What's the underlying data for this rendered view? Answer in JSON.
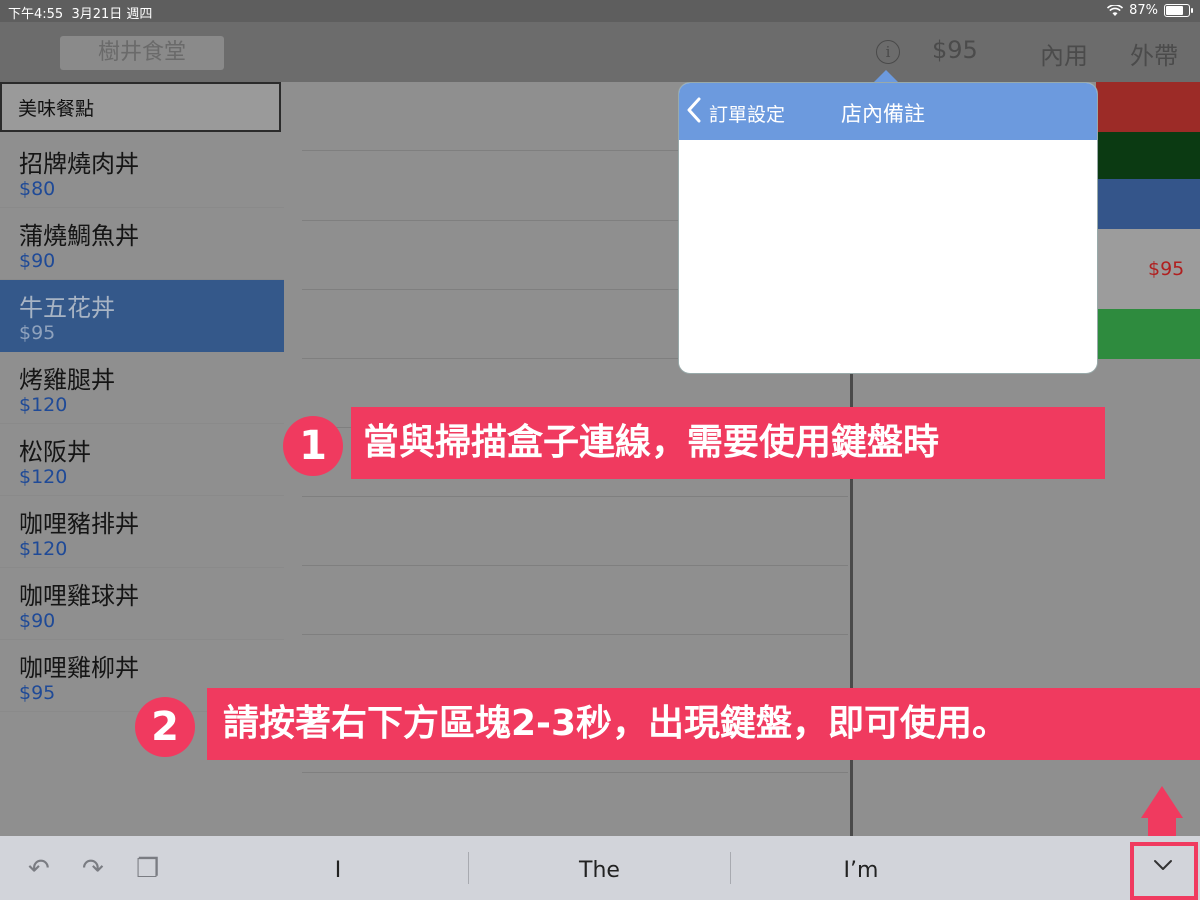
{
  "status_bar": {
    "time": "下午4:55",
    "date": "3月21日 週四",
    "battery": "87%",
    "battery_fraction": 0.87
  },
  "nav": {
    "restaurant": "樹井食堂",
    "total": "$95",
    "dine_in": "內用",
    "takeout": "外帶",
    "info_icon": "ⓘ"
  },
  "category": "美味餐點",
  "menu": [
    {
      "name": "招牌燒肉丼",
      "price": "$80"
    },
    {
      "name": "蒲燒鯛魚丼",
      "price": "$90"
    },
    {
      "name": "牛五花丼",
      "price": "$95",
      "selected": true
    },
    {
      "name": "烤雞腿丼",
      "price": "$120"
    },
    {
      "name": "松阪丼",
      "price": "$120"
    },
    {
      "name": "咖哩豬排丼",
      "price": "$120"
    },
    {
      "name": "咖哩雞球丼",
      "price": "$90"
    },
    {
      "name": "咖哩雞柳丼",
      "price": "$95"
    }
  ],
  "popover": {
    "back_label": "訂單設定",
    "title": "店內備註"
  },
  "right_panel": {
    "price": "$95"
  },
  "annotations": [
    {
      "number": "1",
      "text": "當與掃描盒子連線，需要使用鍵盤時"
    },
    {
      "number": "2",
      "text": "請按著右下方區塊2-3秒，出現鍵盤，即可使用。"
    }
  ],
  "keyboard": {
    "suggestions": [
      "I",
      "The",
      "I’m"
    ],
    "undo_icon": "↶",
    "redo_icon": "↷",
    "paste_icon": "❐",
    "dismiss_icon": "⌄"
  },
  "colors": {
    "accent_red": "#f03a5f",
    "popover_header": "#6c9ade",
    "selected_row": "#34588a"
  }
}
